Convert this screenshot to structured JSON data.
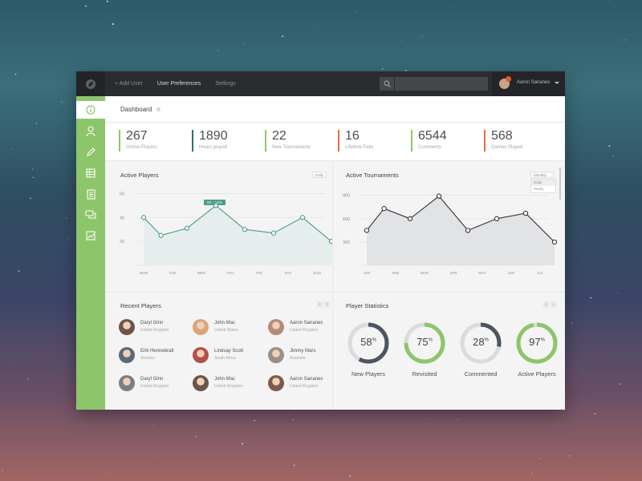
{
  "topbar": {
    "nav": [
      "+ Add User",
      "User Preferences",
      "Settings"
    ],
    "active_nav": "User Preferences",
    "search_placeholder": "",
    "user": {
      "name": "Aaron Sananes",
      "badge_color": "#e55a2a"
    }
  },
  "sidebar": {
    "items": [
      "info-icon",
      "user-icon",
      "pencil-icon",
      "table-icon",
      "document-icon",
      "chat-icon",
      "chart-icon"
    ],
    "accent": "#8dc56b"
  },
  "header": {
    "title": "Dashboard"
  },
  "stats": [
    {
      "value": "267",
      "label": "Online Players",
      "color": "#8dc56b"
    },
    {
      "value": "1890",
      "label": "Hours played",
      "color": "#2e6f73"
    },
    {
      "value": "22",
      "label": "New Tournaments",
      "color": "#8dc56b"
    },
    {
      "value": "16",
      "label": "Lifetime Fails",
      "color": "#e0703a"
    },
    {
      "value": "6544",
      "label": "Comments",
      "color": "#8dc56b"
    },
    {
      "value": "568",
      "label": "Games Played",
      "color": "#e0703a"
    }
  ],
  "active_players": {
    "title": "Active Players",
    "dropdown": "Daily",
    "tooltip": "00 ↑ 14%"
  },
  "active_tournaments": {
    "title": "Active Tournaments",
    "dropdown": "Monthly",
    "menu": [
      "Daily",
      "Yearly"
    ]
  },
  "chart_data": [
    {
      "type": "area",
      "title": "Active Players",
      "categories": [
        "MON",
        "TUE",
        "WED",
        "THU",
        "FRI",
        "SAT",
        "SUN"
      ],
      "values": [
        40,
        25,
        31,
        50,
        30,
        27,
        40,
        20
      ],
      "x_index": [
        0,
        0.6,
        1.5,
        2.5,
        3.5,
        4.5,
        5.5,
        6.5
      ],
      "yticks": [
        "60",
        "40",
        "20"
      ],
      "ylim": [
        0,
        65
      ],
      "line_color": "#4a9a8f",
      "fill_color": "#e6eeed",
      "grid": true
    },
    {
      "type": "area",
      "title": "Active Tournaments",
      "categories": [
        "JAN",
        "FEB",
        "MAR",
        "APR",
        "MAY",
        "JUN",
        "JUL"
      ],
      "values": [
        450,
        730,
        600,
        890,
        450,
        600,
        670,
        300
      ],
      "x_index": [
        0,
        0.6,
        1.5,
        2.5,
        3.5,
        4.5,
        5.5,
        6.5
      ],
      "yticks": [
        "900",
        "600",
        "300"
      ],
      "ylim": [
        0,
        1000
      ],
      "line_color": "#2f3238",
      "fill_color": "#e2e3e5",
      "grid": true
    }
  ],
  "recent_players": {
    "title": "Recent Players",
    "players": [
      {
        "name": "Daryl Ginn",
        "country": "United Kingdom",
        "color": "#6d5548"
      },
      {
        "name": "John Mac",
        "country": "United States",
        "color": "#d9a67a"
      },
      {
        "name": "Aaron Sananes",
        "country": "United Kingdom",
        "color": "#b7897a"
      },
      {
        "name": "Erik Hennebratt",
        "country": "Sweden",
        "color": "#5a6a78"
      },
      {
        "name": "Lindsay Scott",
        "country": "South Africa",
        "color": "#b3504a"
      },
      {
        "name": "Jimmy Mars",
        "country": "Australia",
        "color": "#9a8f85"
      },
      {
        "name": "Daryl Ginn",
        "country": "United Kingdom",
        "color": "#7a7e85"
      },
      {
        "name": "John Mac",
        "country": "United Kingdom",
        "color": "#6b5448"
      },
      {
        "name": "Aaron Sananes",
        "country": "United Kingdom",
        "color": "#7a5b4a"
      }
    ]
  },
  "player_statistics": {
    "title": "Player Statistics",
    "items": [
      {
        "value": 58,
        "label": "New Players",
        "color": "#4c5560"
      },
      {
        "value": 75,
        "label": "Revisited",
        "color": "#8dc56b"
      },
      {
        "value": 28,
        "label": "Commented",
        "color": "#4c5560"
      },
      {
        "value": 97,
        "label": "Active Players",
        "color": "#8dc56b"
      }
    ],
    "track_color": "#d9dbde"
  }
}
